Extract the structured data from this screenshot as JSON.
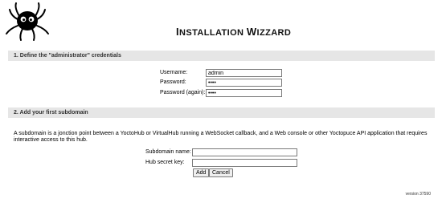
{
  "title": {
    "first_letter": "I",
    "rest1": "NSTALLATION ",
    "second_letter": "W",
    "rest2": "IZZARD"
  },
  "section1": {
    "heading": "1. Define the \"administrator\" credentials",
    "username_label": "Username:",
    "username_value": "admin",
    "password_label": "Password:",
    "password_value": "••••",
    "password_again_label": "Password (again):",
    "password_again_value": "••••"
  },
  "section2": {
    "heading": "2. Add your first subdomain",
    "description": "A subdomain is a jonction point between a YoctoHub or VirtualHub running a WebSocket callback, and a Web console or other Yoctopuce API application that requires interactive access to this hub.",
    "subdomain_label": "Subdomain name:",
    "subdomain_value": "",
    "secret_label": "Hub secret key:",
    "secret_value": "",
    "add_label": "Add",
    "cancel_label": "Cancel"
  },
  "version": "version 37590",
  "icons": {
    "logo": "octopus-logo-icon"
  }
}
